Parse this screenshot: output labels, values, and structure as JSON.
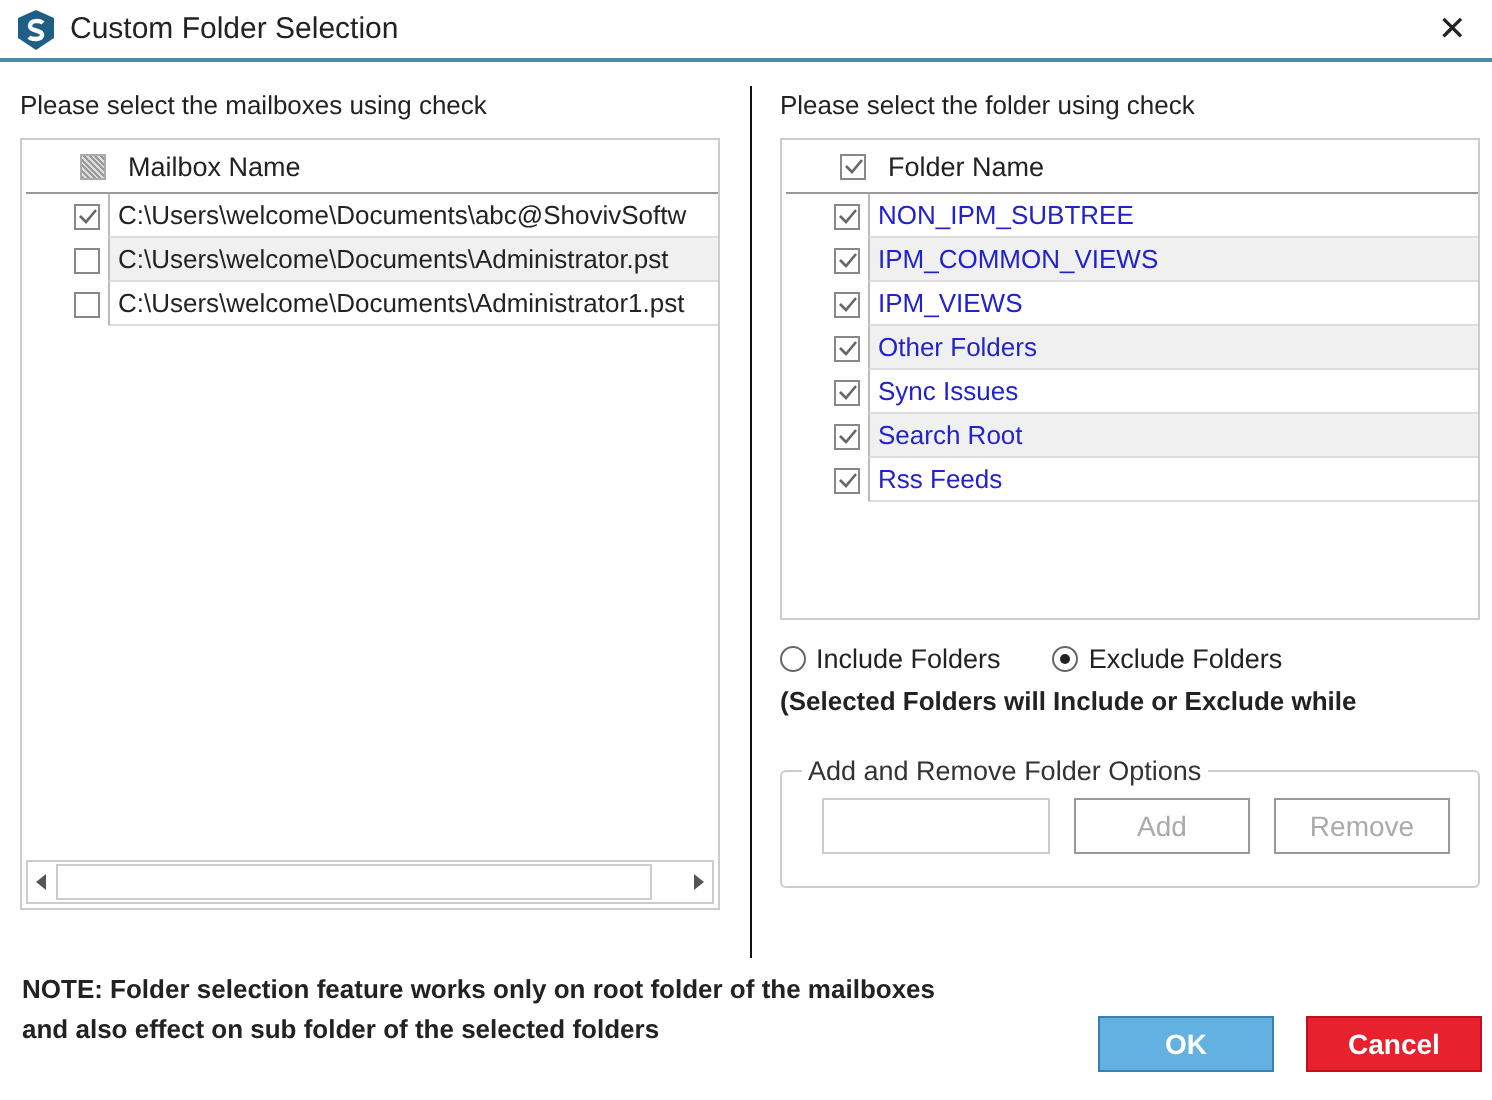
{
  "window": {
    "title": "Custom Folder Selection",
    "close": "✕"
  },
  "mailboxes": {
    "instruction": "Please select the mailboxes using check",
    "header": {
      "label": "Mailbox Name",
      "indeterminate": true
    },
    "rows": [
      {
        "path": "C:\\Users\\welcome\\Documents\\abc@ShovivSoftw",
        "checked": true
      },
      {
        "path": "C:\\Users\\welcome\\Documents\\Administrator.pst",
        "checked": false
      },
      {
        "path": "C:\\Users\\welcome\\Documents\\Administrator1.pst",
        "checked": false
      }
    ]
  },
  "folders": {
    "instruction": "Please select the folder using check",
    "header": {
      "label": "Folder Name",
      "checked": true
    },
    "rows": [
      {
        "name": "NON_IPM_SUBTREE",
        "checked": true
      },
      {
        "name": "IPM_COMMON_VIEWS",
        "checked": true
      },
      {
        "name": "IPM_VIEWS",
        "checked": true
      },
      {
        "name": "Other Folders",
        "checked": true
      },
      {
        "name": "Sync Issues",
        "checked": true
      },
      {
        "name": "Search Root",
        "checked": true
      },
      {
        "name": "Rss Feeds",
        "checked": true
      }
    ]
  },
  "mode": [
    {
      "label": "Include Folders",
      "selected": false
    },
    {
      "label": "Exclude Folders",
      "selected": true
    }
  ],
  "mode_note": "(Selected Folders will Include or Exclude while",
  "options_group": {
    "title": "Add and Remove Folder Options",
    "buttons": [
      {
        "label": "Add",
        "disabled": true
      },
      {
        "label": "Remove",
        "disabled": true
      }
    ]
  },
  "note": [
    "NOTE: Folder selection feature works only on root folder of the mailboxes",
    "and also effect on sub folder of the selected folders"
  ],
  "buttons": [
    {
      "label": "OK",
      "kind": "primary"
    },
    {
      "label": "Cancel",
      "kind": "danger"
    }
  ]
}
